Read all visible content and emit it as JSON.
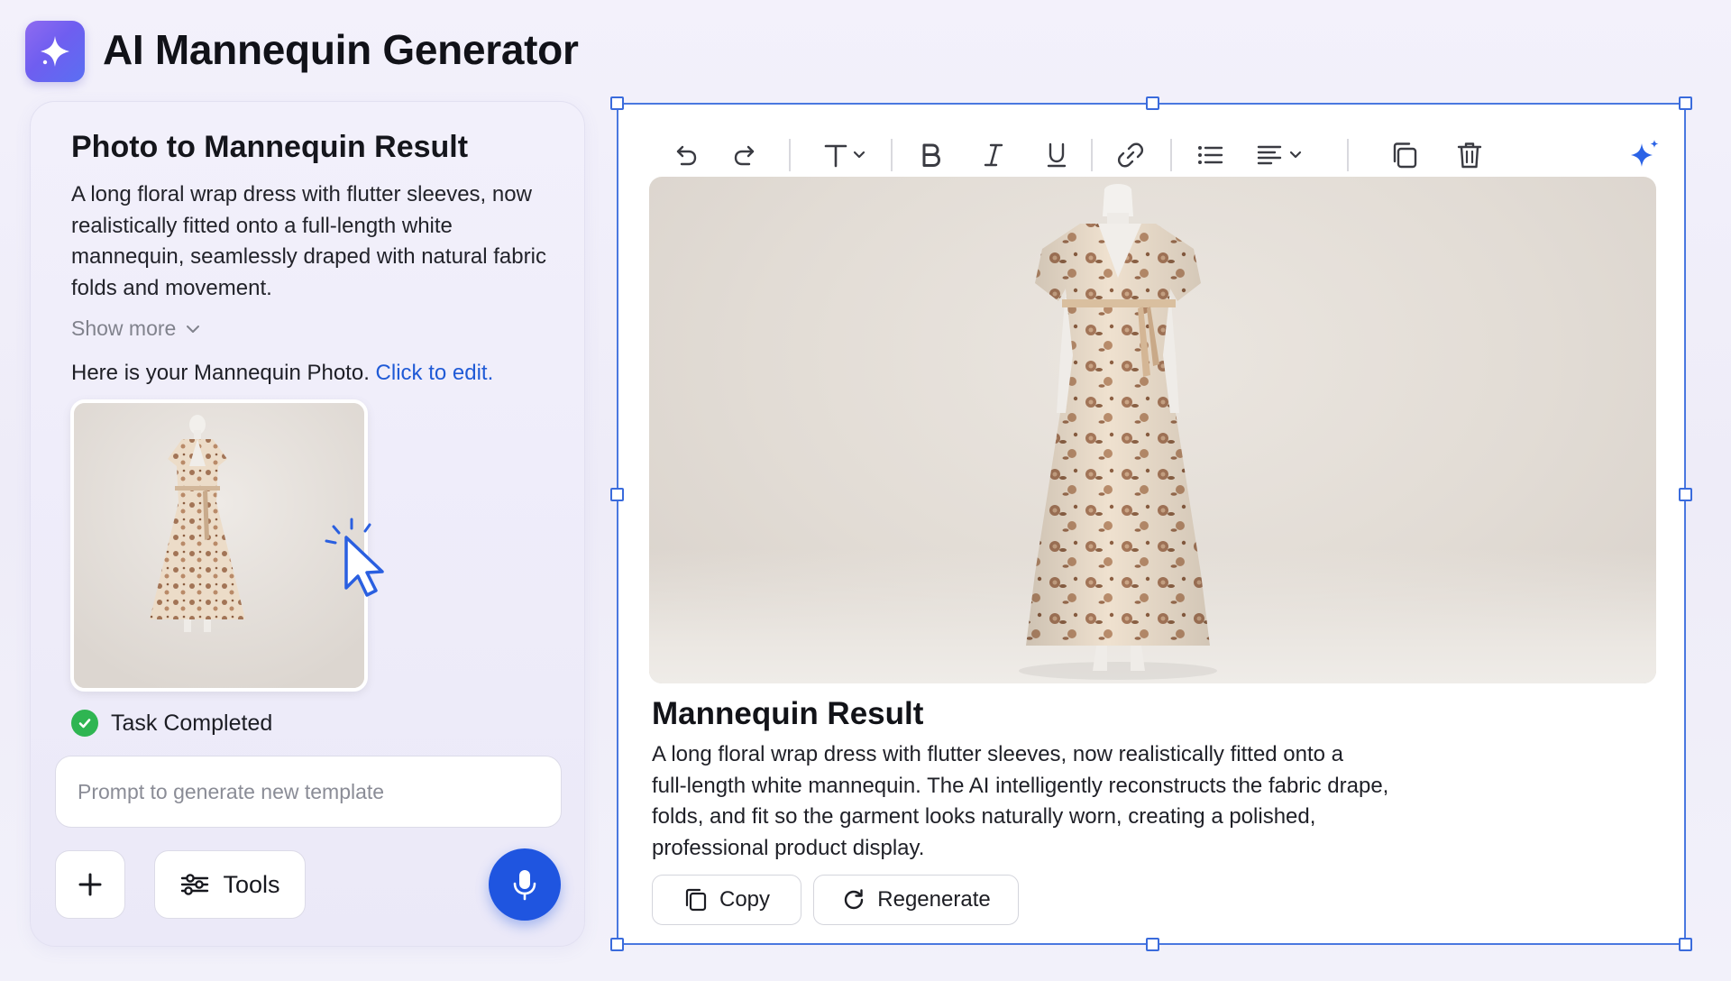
{
  "header": {
    "title": "AI Mannequin Generator",
    "logo_icon": "sparkle-icon",
    "logo_gradient": [
      "#8f6bf0",
      "#5a6ff2"
    ]
  },
  "left_panel": {
    "title": "Photo to Mannequin Result",
    "description": "A long floral wrap dress with flutter sleeves, now realistically fitted onto a full-length white mannequin, seamlessly draped with natural fabric folds and movement.",
    "show_more_label": "Show more",
    "edit_prefix": "Here is your Mannequin Photo.",
    "edit_link": "Click to edit.",
    "thumbnail_icon": "dress-on-mannequin-image",
    "task_status": "Task Completed",
    "prompt_placeholder": "Prompt to generate new template",
    "prompt_value": "",
    "add_icon": "plus-icon",
    "tools_label": "Tools",
    "tools_icon": "sliders-icon",
    "mic_icon": "microphone-icon"
  },
  "editor": {
    "toolbar_icons": [
      "undo-icon",
      "redo-icon",
      "text-style-icon",
      "bold-icon",
      "italic-icon",
      "underline-icon",
      "link-icon",
      "bullet-list-icon",
      "align-icon",
      "duplicate-icon",
      "delete-icon",
      "ai-sparkle-icon"
    ],
    "image_icon": "dress-on-mannequin-image",
    "result_title": "Mannequin Result",
    "result_desc_lines": [
      "A long floral wrap dress with flutter sleeves, now realistically fitted onto a",
      "full-length white mannequin. The AI intelligently reconstructs the fabric drape,",
      "folds, and fit so the garment looks naturally worn, creating a polished,",
      "professional product display."
    ],
    "copy_label": "Copy",
    "regenerate_label": "Regenerate"
  },
  "colors": {
    "accent_blue": "#1f55e0",
    "link_blue": "#1f5ad6",
    "selection_border": "#4a78e0",
    "success_green": "#2fb552"
  }
}
